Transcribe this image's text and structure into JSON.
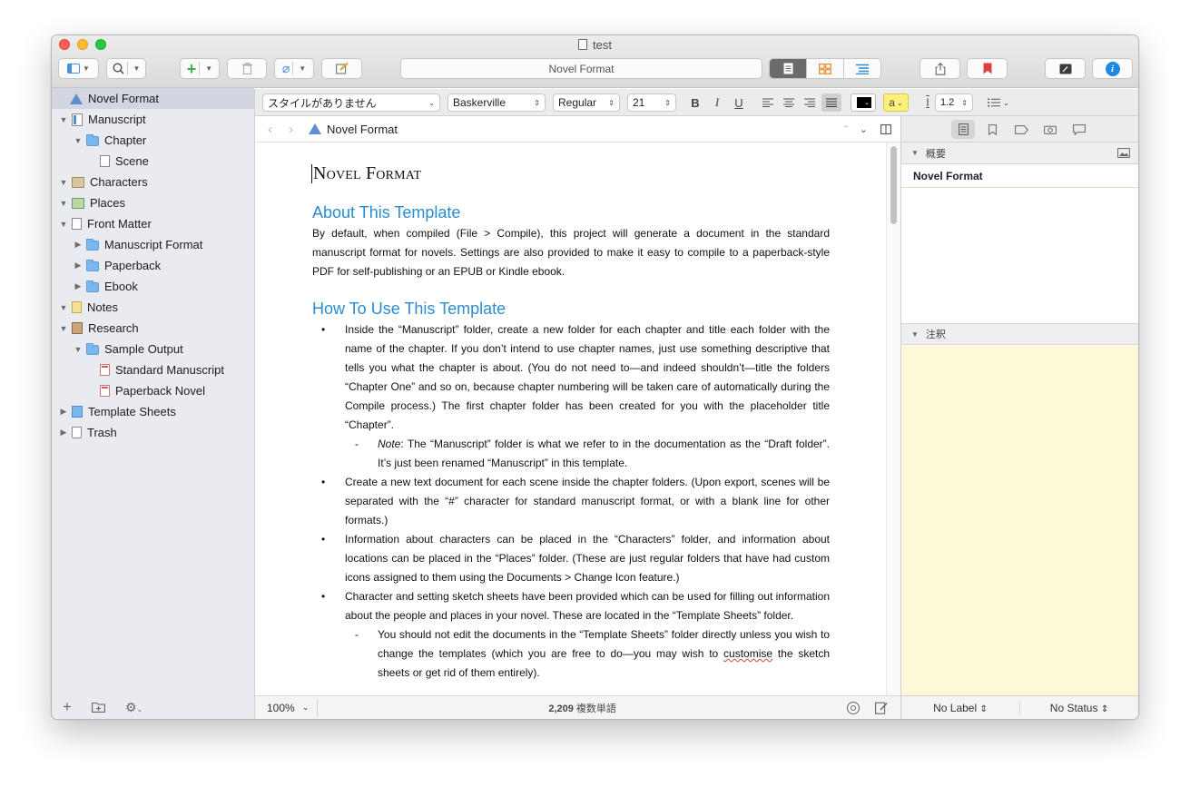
{
  "window": {
    "title": "test"
  },
  "toolbar": {
    "view_mode": "Novel Format",
    "accent": "#2c8ccf",
    "bookmark_color": "#e0403c",
    "info_color": "#1e88e5"
  },
  "format_bar": {
    "style": "スタイルがありません",
    "font": "Baskerville",
    "weight": "Regular",
    "size": "21",
    "bold": "B",
    "italic": "I",
    "underline": "U",
    "highlight": "a",
    "line_spacing": "1.2"
  },
  "binder": {
    "items": [
      {
        "label": "Novel Format",
        "icon": "warning-icon",
        "depth": 0,
        "disclosure": "",
        "selected": true
      },
      {
        "label": "Manuscript",
        "icon": "draft-icon",
        "depth": 0,
        "disclosure": "▼"
      },
      {
        "label": "Chapter",
        "icon": "folder-icon",
        "depth": 1,
        "disclosure": "▼"
      },
      {
        "label": "Scene",
        "icon": "document-icon",
        "depth": 2,
        "disclosure": ""
      },
      {
        "label": "Characters",
        "icon": "characters-icon",
        "depth": 0,
        "disclosure": "▼"
      },
      {
        "label": "Places",
        "icon": "places-icon",
        "depth": 0,
        "disclosure": "▼"
      },
      {
        "label": "Front Matter",
        "icon": "document-icon",
        "depth": 0,
        "disclosure": "▼"
      },
      {
        "label": "Manuscript Format",
        "icon": "folder-icon",
        "depth": 1,
        "disclosure": "▶"
      },
      {
        "label": "Paperback",
        "icon": "folder-icon",
        "depth": 1,
        "disclosure": "▶"
      },
      {
        "label": "Ebook",
        "icon": "folder-icon",
        "depth": 1,
        "disclosure": "▶"
      },
      {
        "label": "Notes",
        "icon": "notes-icon",
        "depth": 0,
        "disclosure": "▼"
      },
      {
        "label": "Research",
        "icon": "research-icon",
        "depth": 0,
        "disclosure": "▼"
      },
      {
        "label": "Sample Output",
        "icon": "folder-icon",
        "depth": 1,
        "disclosure": "▼"
      },
      {
        "label": "Standard Manuscript",
        "icon": "pdf-icon",
        "depth": 2,
        "disclosure": ""
      },
      {
        "label": "Paperback Novel",
        "icon": "pdf-icon",
        "depth": 2,
        "disclosure": ""
      },
      {
        "label": "Template Sheets",
        "icon": "template-sheets-icon",
        "depth": 0,
        "disclosure": "▶"
      },
      {
        "label": "Trash",
        "icon": "trash-icon",
        "depth": 0,
        "disclosure": "▶"
      }
    ]
  },
  "editor": {
    "header_title": "Novel Format",
    "doc_title": "Novel Format",
    "about_heading": "About This Template",
    "about_text": "By default, when compiled (File > Compile), this project will generate a document in the standard manuscript format for novels. Settings are also provided to make it easy to compile to a paperback-style PDF for self-publishing or an EPUB or Kindle ebook.",
    "howto_heading": "How To Use This Template",
    "b1": "Inside the “Manuscript” folder, create a new folder for each chapter and title each folder with the name of the chapter. If you don’t intend to use chapter names, just use something descriptive that tells you what the chapter is about. (You do not need to—and indeed shouldn’t—title the folders “Chapter One” and so on, because chapter numbering will be taken care of automatically during the Compile process.) The first chapter folder has been created for you with the placeholder title “Chapter”.",
    "b1_note_label": "Note",
    "b1_note": ": The “Manuscript” folder is what we refer to in the documentation as the “Draft folder”. It’s just been renamed “Manuscript” in this template.",
    "b2": "Create a new text document for each scene inside the chapter folders. (Upon export, scenes will be separated with the “#” character for standard manuscript format, or with a blank line for other formats.)",
    "b3": "Information about characters can be placed in the “Characters” folder, and information about locations can be placed in the “Places” folder. (These are just regular folders that have had custom icons assigned to them using the Documents > Change Icon feature.)",
    "b4": "Character and setting sketch sheets have been provided which can be used for filling out information about the people and places in your novel. These are located in the “Template Sheets” folder.",
    "b4_sub_a": "You should not edit the documents in the “Template Sheets” folder directly unless you wish to change the templates (which you are free to do—you may wish to ",
    "b4_sub_misspelled": "customise",
    "b4_sub_b": " the sketch sheets or get rid of them entirely).",
    "zoom": "100%",
    "word_count": "2,209",
    "word_count_suffix": "複数単語"
  },
  "inspector": {
    "synopsis_header": "概要",
    "synopsis_title": "Novel Format",
    "notes_header": "注釈",
    "notes_bg": "#fdf8d8",
    "label": "No Label",
    "status": "No Status"
  }
}
